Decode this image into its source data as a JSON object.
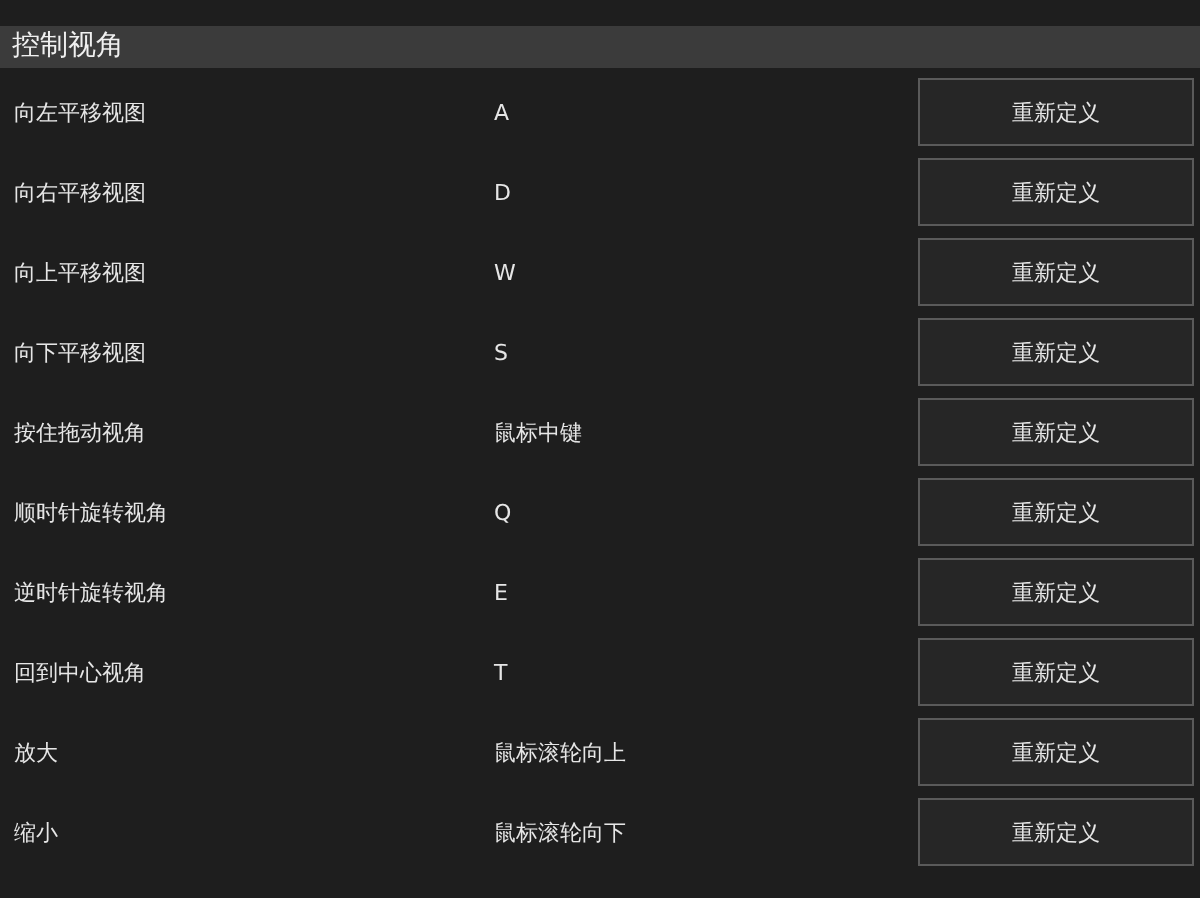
{
  "section_title": "控制视角",
  "bindings": [
    {
      "action": "向左平移视图",
      "key": "A",
      "button": "重新定义"
    },
    {
      "action": "向右平移视图",
      "key": "D",
      "button": "重新定义"
    },
    {
      "action": "向上平移视图",
      "key": "W",
      "button": "重新定义"
    },
    {
      "action": "向下平移视图",
      "key": "S",
      "button": "重新定义"
    },
    {
      "action": "按住拖动视角",
      "key": "鼠标中键",
      "button": "重新定义"
    },
    {
      "action": "顺时针旋转视角",
      "key": "Q",
      "button": "重新定义"
    },
    {
      "action": "逆时针旋转视角",
      "key": "E",
      "button": "重新定义"
    },
    {
      "action": "回到中心视角",
      "key": "T",
      "button": "重新定义"
    },
    {
      "action": "放大",
      "key": "鼠标滚轮向上",
      "button": "重新定义"
    },
    {
      "action": "缩小",
      "key": "鼠标滚轮向下",
      "button": "重新定义"
    }
  ]
}
